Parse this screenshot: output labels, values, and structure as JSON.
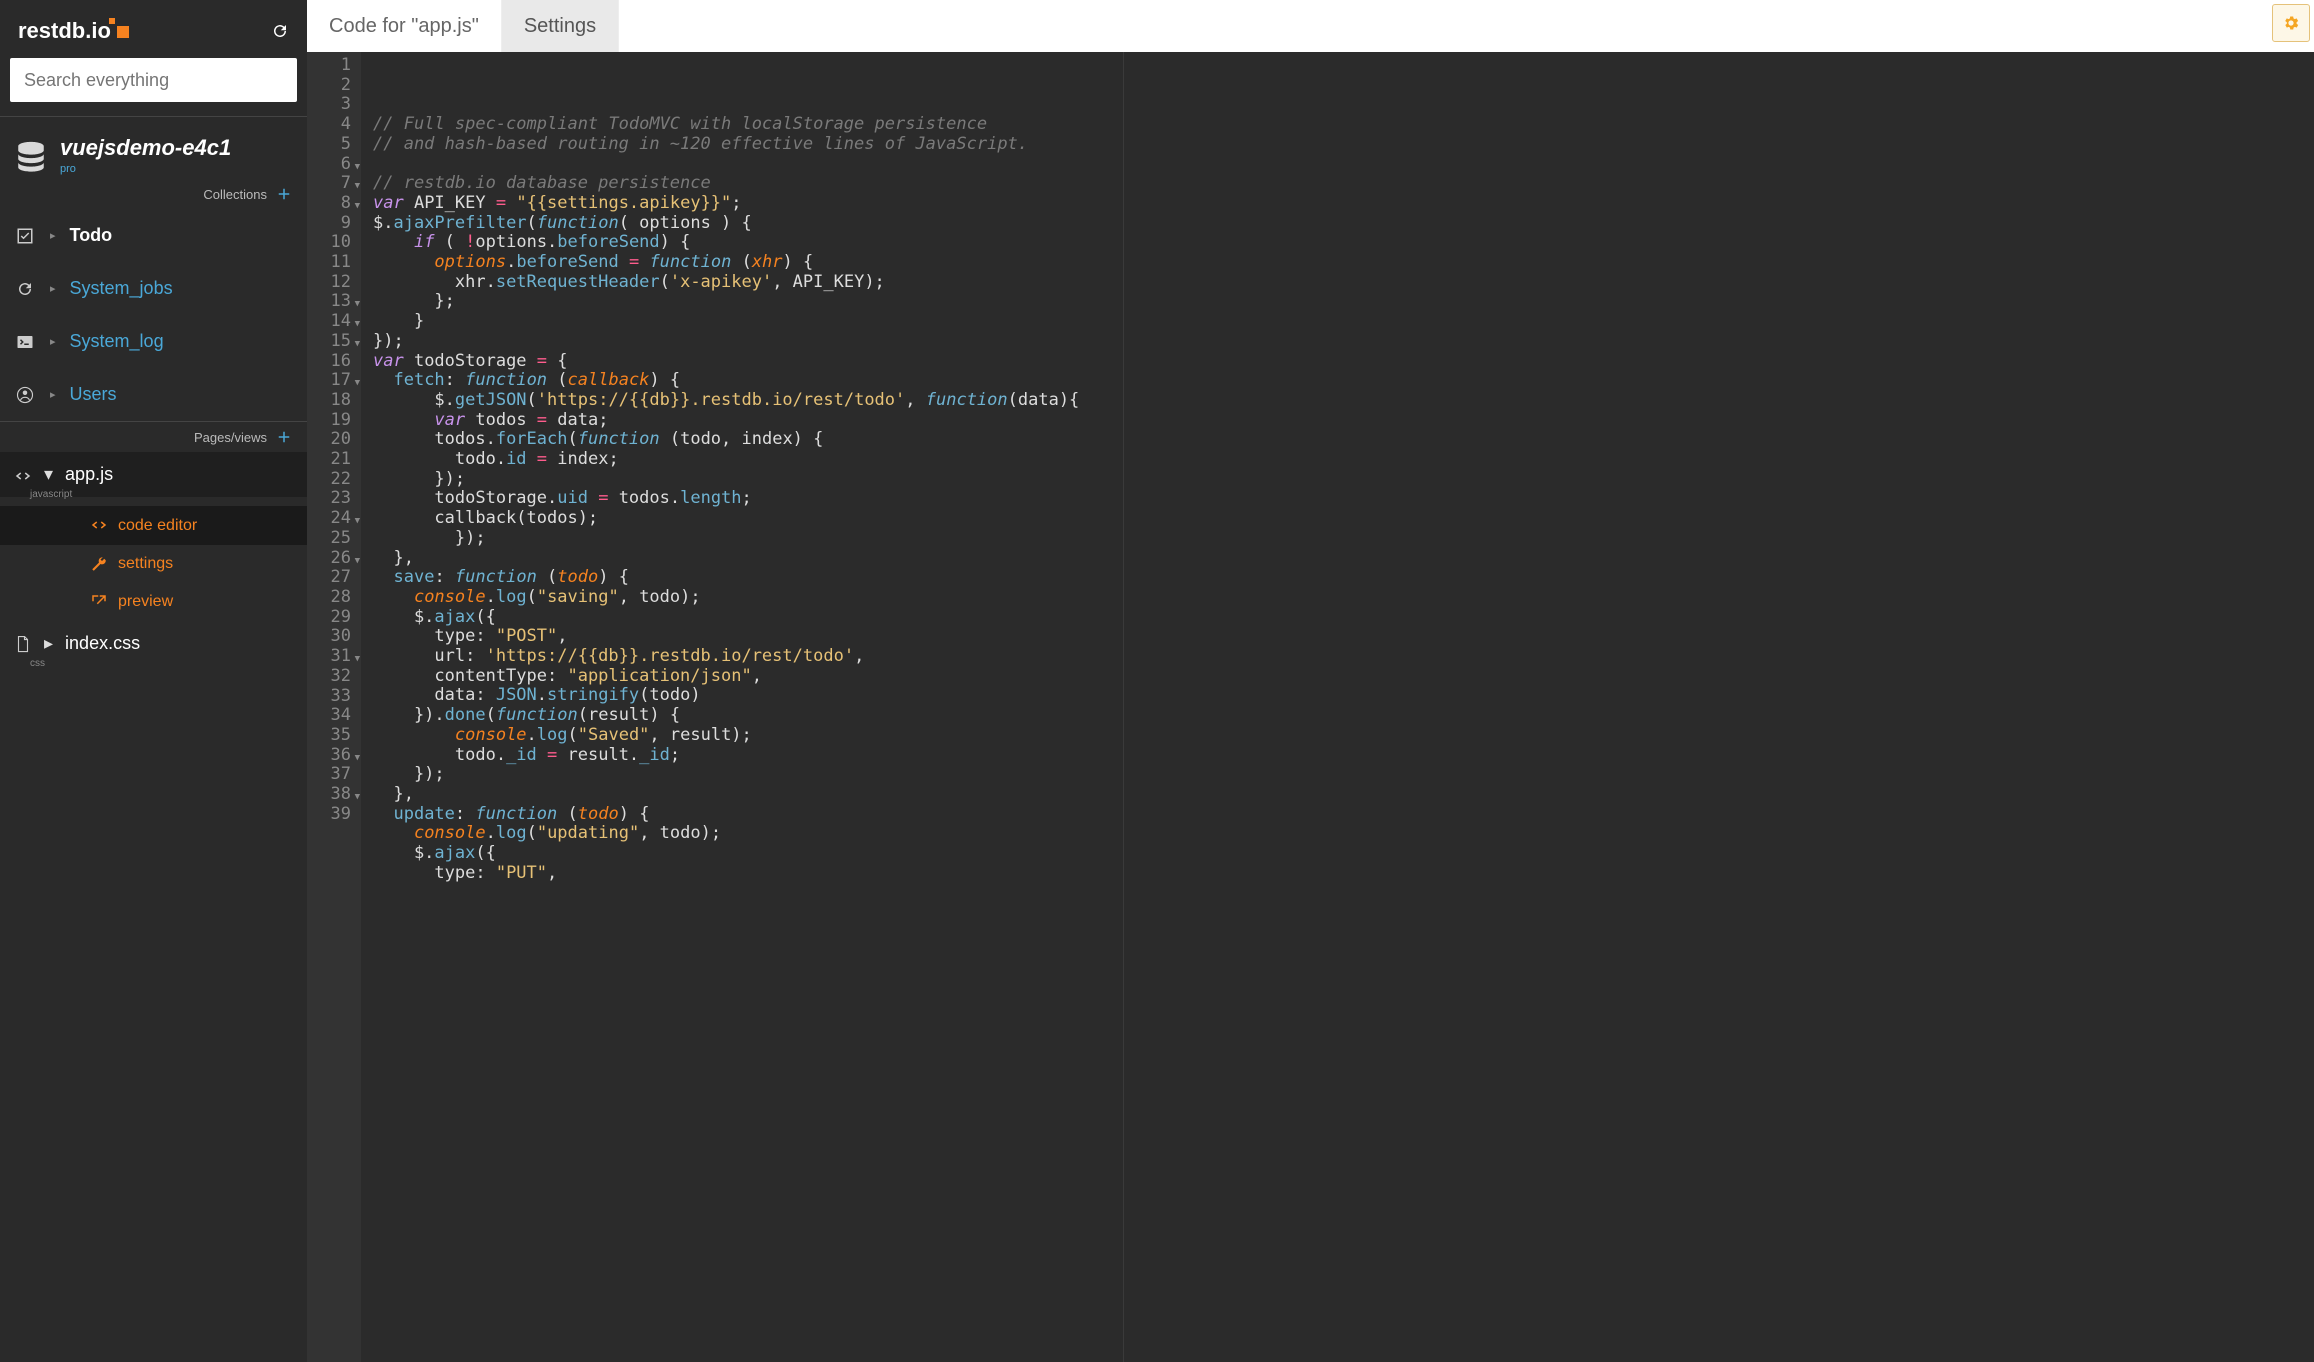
{
  "brand": "restdb.io",
  "search": {
    "placeholder": "Search everything"
  },
  "database": {
    "name": "vuejsdemo-e4c1",
    "plan": "pro"
  },
  "sections": {
    "collections_label": "Collections",
    "pages_label": "Pages/views"
  },
  "collections": [
    {
      "label": "Todo",
      "kind": "check",
      "link": false
    },
    {
      "label": "System_jobs",
      "kind": "refresh",
      "link": true
    },
    {
      "label": "System_log",
      "kind": "terminal",
      "link": true
    },
    {
      "label": "Users",
      "kind": "user",
      "link": true
    }
  ],
  "pages": [
    {
      "label": "app.js",
      "subtype": "javascript",
      "expanded": true,
      "children": [
        {
          "label": "code editor",
          "icon": "code",
          "selected": true
        },
        {
          "label": "settings",
          "icon": "wrench",
          "selected": false
        },
        {
          "label": "preview",
          "icon": "external",
          "selected": false
        }
      ]
    },
    {
      "label": "index.css",
      "subtype": "css",
      "expanded": false
    }
  ],
  "tabs": [
    {
      "label": "Code for \"app.js\"",
      "active": true
    },
    {
      "label": "Settings",
      "active": false
    }
  ],
  "editor": {
    "first_line": 1,
    "fold_lines": [
      6,
      7,
      8,
      13,
      14,
      15,
      17,
      24,
      26,
      31,
      36,
      38
    ],
    "lines": [
      [
        [
          "cm",
          "// Full spec-compliant TodoMVC with localStorage persistence"
        ]
      ],
      [
        [
          "cm",
          "// and hash-based routing in ~120 effective lines of JavaScript."
        ]
      ],
      [],
      [
        [
          "cm",
          "// restdb.io database persistence"
        ]
      ],
      [
        [
          "kw",
          "var"
        ],
        [
          "nm",
          " API_KEY "
        ],
        [
          "op",
          "="
        ],
        [
          "nm",
          " "
        ],
        [
          "str",
          "\"{{settings.apikey}}\""
        ],
        [
          "nm",
          ";"
        ]
      ],
      [
        [
          "nm",
          "$."
        ],
        [
          "met",
          "ajaxPrefilter"
        ],
        [
          "nm",
          "("
        ],
        [
          "fn",
          "function"
        ],
        [
          "nm",
          "( options ) {"
        ]
      ],
      [
        [
          "nm",
          "    "
        ],
        [
          "kw",
          "if"
        ],
        [
          "nm",
          " ( "
        ],
        [
          "op",
          "!"
        ],
        [
          "nm",
          "options."
        ],
        [
          "met",
          "beforeSend"
        ],
        [
          "nm",
          ") {"
        ]
      ],
      [
        [
          "nm",
          "      "
        ],
        [
          "prm",
          "options"
        ],
        [
          "nm",
          "."
        ],
        [
          "met",
          "beforeSend"
        ],
        [
          "nm",
          " "
        ],
        [
          "op",
          "="
        ],
        [
          "nm",
          " "
        ],
        [
          "fn",
          "function"
        ],
        [
          "nm",
          " ("
        ],
        [
          "prm",
          "xhr"
        ],
        [
          "nm",
          ") {"
        ]
      ],
      [
        [
          "nm",
          "        xhr."
        ],
        [
          "met",
          "setRequestHeader"
        ],
        [
          "nm",
          "("
        ],
        [
          "str",
          "'x-apikey'"
        ],
        [
          "nm",
          ", API_KEY);"
        ]
      ],
      [
        [
          "nm",
          "      };"
        ]
      ],
      [
        [
          "nm",
          "    }"
        ]
      ],
      [
        [
          "nm",
          "});"
        ]
      ],
      [
        [
          "kw",
          "var"
        ],
        [
          "nm",
          " todoStorage "
        ],
        [
          "op",
          "="
        ],
        [
          "nm",
          " {"
        ]
      ],
      [
        [
          "nm",
          "  "
        ],
        [
          "prop",
          "fetch"
        ],
        [
          "nm",
          ": "
        ],
        [
          "fn",
          "function"
        ],
        [
          "nm",
          " ("
        ],
        [
          "prm",
          "callback"
        ],
        [
          "nm",
          ") {"
        ]
      ],
      [
        [
          "nm",
          "      $."
        ],
        [
          "met",
          "getJSON"
        ],
        [
          "nm",
          "("
        ],
        [
          "str",
          "'https://{{db}}.restdb.io/rest/todo'"
        ],
        [
          "nm",
          ", "
        ],
        [
          "fn",
          "function"
        ],
        [
          "nm",
          "(data){"
        ]
      ],
      [
        [
          "nm",
          "      "
        ],
        [
          "kw",
          "var"
        ],
        [
          "nm",
          " todos "
        ],
        [
          "op",
          "="
        ],
        [
          "nm",
          " data;"
        ]
      ],
      [
        [
          "nm",
          "      todos."
        ],
        [
          "met",
          "forEach"
        ],
        [
          "nm",
          "("
        ],
        [
          "fn",
          "function"
        ],
        [
          "nm",
          " (todo, index) {"
        ]
      ],
      [
        [
          "nm",
          "        todo."
        ],
        [
          "met",
          "id"
        ],
        [
          "nm",
          " "
        ],
        [
          "op",
          "="
        ],
        [
          "nm",
          " index;"
        ]
      ],
      [
        [
          "nm",
          "      });"
        ]
      ],
      [
        [
          "nm",
          "      todoStorage."
        ],
        [
          "met",
          "uid"
        ],
        [
          "nm",
          " "
        ],
        [
          "op",
          "="
        ],
        [
          "nm",
          " todos."
        ],
        [
          "met",
          "length"
        ],
        [
          "nm",
          ";"
        ]
      ],
      [
        [
          "nm",
          "      callback(todos);"
        ]
      ],
      [
        [
          "nm",
          "        });"
        ]
      ],
      [
        [
          "nm",
          "  },"
        ]
      ],
      [
        [
          "nm",
          "  "
        ],
        [
          "prop",
          "save"
        ],
        [
          "nm",
          ": "
        ],
        [
          "fn",
          "function"
        ],
        [
          "nm",
          " ("
        ],
        [
          "prm",
          "todo"
        ],
        [
          "nm",
          ") {"
        ]
      ],
      [
        [
          "nm",
          "    "
        ],
        [
          "prm",
          "console"
        ],
        [
          "nm",
          "."
        ],
        [
          "met",
          "log"
        ],
        [
          "nm",
          "("
        ],
        [
          "str",
          "\"saving\""
        ],
        [
          "nm",
          ", todo);"
        ]
      ],
      [
        [
          "nm",
          "    $."
        ],
        [
          "met",
          "ajax"
        ],
        [
          "nm",
          "({"
        ]
      ],
      [
        [
          "nm",
          "      type: "
        ],
        [
          "str",
          "\"POST\""
        ],
        [
          "nm",
          ","
        ]
      ],
      [
        [
          "nm",
          "      url: "
        ],
        [
          "str",
          "'https://{{db}}.restdb.io/rest/todo'"
        ],
        [
          "nm",
          ","
        ]
      ],
      [
        [
          "nm",
          "      contentType: "
        ],
        [
          "str",
          "\"application/json\""
        ],
        [
          "nm",
          ","
        ]
      ],
      [
        [
          "nm",
          "      data: "
        ],
        [
          "met",
          "JSON"
        ],
        [
          "nm",
          "."
        ],
        [
          "met",
          "stringify"
        ],
        [
          "nm",
          "(todo)"
        ]
      ],
      [
        [
          "nm",
          "    })."
        ],
        [
          "met",
          "done"
        ],
        [
          "nm",
          "("
        ],
        [
          "fn",
          "function"
        ],
        [
          "nm",
          "(result) {"
        ]
      ],
      [
        [
          "nm",
          "        "
        ],
        [
          "prm",
          "console"
        ],
        [
          "nm",
          "."
        ],
        [
          "met",
          "log"
        ],
        [
          "nm",
          "("
        ],
        [
          "str",
          "\"Saved\""
        ],
        [
          "nm",
          ", result);"
        ]
      ],
      [
        [
          "nm",
          "        todo."
        ],
        [
          "met",
          "_id"
        ],
        [
          "nm",
          " "
        ],
        [
          "op",
          "="
        ],
        [
          "nm",
          " result."
        ],
        [
          "met",
          "_id"
        ],
        [
          "nm",
          ";"
        ]
      ],
      [
        [
          "nm",
          "    });"
        ]
      ],
      [
        [
          "nm",
          "  },"
        ]
      ],
      [
        [
          "nm",
          "  "
        ],
        [
          "prop",
          "update"
        ],
        [
          "nm",
          ": "
        ],
        [
          "fn",
          "function"
        ],
        [
          "nm",
          " ("
        ],
        [
          "prm",
          "todo"
        ],
        [
          "nm",
          ") {"
        ]
      ],
      [
        [
          "nm",
          "    "
        ],
        [
          "prm",
          "console"
        ],
        [
          "nm",
          "."
        ],
        [
          "met",
          "log"
        ],
        [
          "nm",
          "("
        ],
        [
          "str",
          "\"updating\""
        ],
        [
          "nm",
          ", todo);"
        ]
      ],
      [
        [
          "nm",
          "    $."
        ],
        [
          "met",
          "ajax"
        ],
        [
          "nm",
          "({"
        ]
      ],
      [
        [
          "nm",
          "      type: "
        ],
        [
          "str",
          "\"PUT\""
        ],
        [
          "nm",
          ","
        ]
      ]
    ]
  }
}
